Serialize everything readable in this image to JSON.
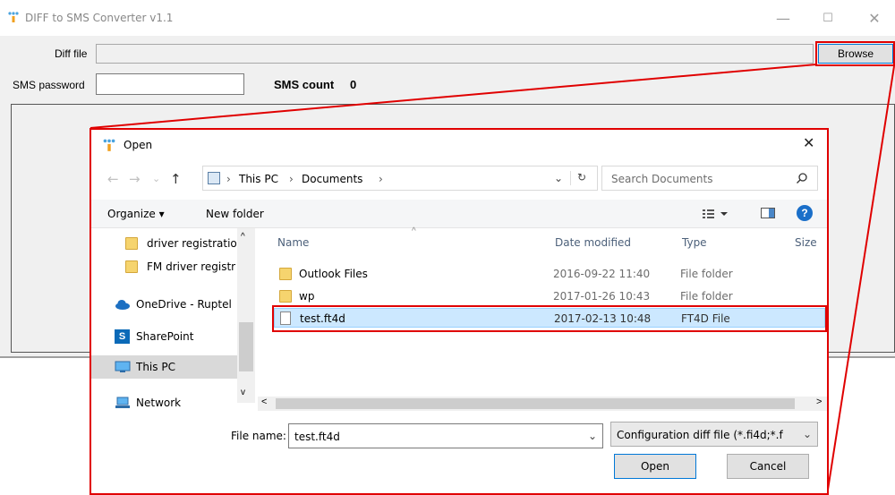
{
  "app": {
    "title": "DIFF to SMS Converter v1.1",
    "minimize": "—",
    "maximize": "☐",
    "close": "✕",
    "diff_label": "Diff file",
    "diff_value": "",
    "browse": "Browse",
    "sms_password_label": "SMS password",
    "sms_password_value": "",
    "sms_count_label": "SMS count",
    "sms_count_value": "0"
  },
  "dialog": {
    "title": "Open",
    "close": "✕",
    "nav_back": "←",
    "nav_forward": "→",
    "nav_recent": "⌄",
    "nav_up": "↑",
    "breadcrumb": [
      "This PC",
      "Documents"
    ],
    "breadcrumb_sep": "›",
    "refresh": "↻",
    "search_placeholder": "Search Documents",
    "organize": "Organize ▾",
    "new_folder": "New folder",
    "nav_items": [
      {
        "label": "driver registratio"
      },
      {
        "label": "FM driver registr"
      },
      {
        "label": "OneDrive - Ruptel"
      },
      {
        "label": "SharePoint"
      },
      {
        "label": "This PC"
      },
      {
        "label": "Network"
      }
    ],
    "columns": [
      "Name",
      "Date modified",
      "Type",
      "Size"
    ],
    "files": [
      {
        "name": "Outlook Files",
        "date": "2016-09-22 11:40",
        "type": "File folder"
      },
      {
        "name": "wp",
        "date": "2017-01-26 10:43",
        "type": "File folder"
      },
      {
        "name": "test.ft4d",
        "date": "2017-02-13 10:48",
        "type": "FT4D File"
      }
    ],
    "file_name_label": "File name:",
    "file_name_value": "test.ft4d",
    "file_type": "Configuration diff file (*.fi4d;*.f",
    "open_btn": "Open",
    "cancel_btn": "Cancel"
  },
  "colors": {
    "highlight": "#e00000",
    "selection": "#cce8ff",
    "accent": "#0078d7"
  }
}
